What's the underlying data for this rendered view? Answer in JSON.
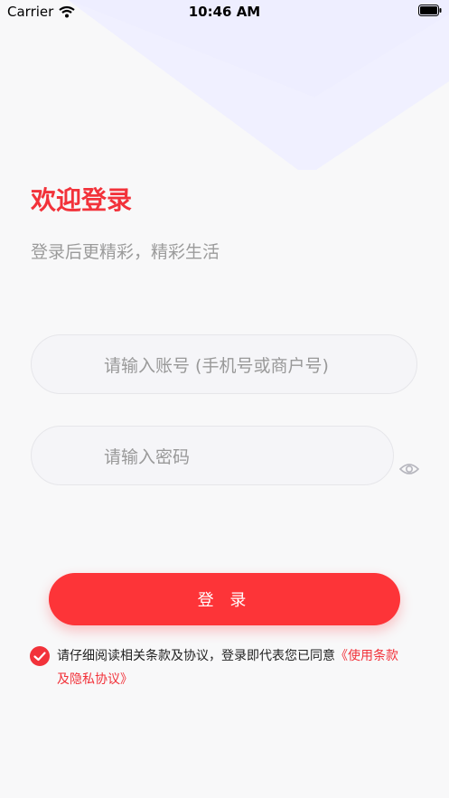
{
  "status_bar": {
    "carrier": "Carrier",
    "time": "10:46 AM"
  },
  "login": {
    "title": "欢迎登录",
    "subtitle": "登录后更精彩，精彩生活",
    "account_placeholder": "请输入账号 (手机号或商户号)",
    "password_placeholder": "请输入密码",
    "button_label": "登 录"
  },
  "agreement": {
    "prefix": "请仔细阅读相关条款及协议，登录即代表您已同意",
    "link": "《使用条款及隐私协议》"
  },
  "colors": {
    "accent": "#fd3438",
    "title": "#f2323a",
    "background": "#f8f8f9",
    "input_bg": "#f5f5f8",
    "placeholder": "#999999",
    "decoration": "#eeeeff"
  },
  "icons": {
    "wifi": "wifi-icon",
    "battery": "battery-icon",
    "eye": "eye-icon",
    "check": "checkmark-circle-icon"
  }
}
